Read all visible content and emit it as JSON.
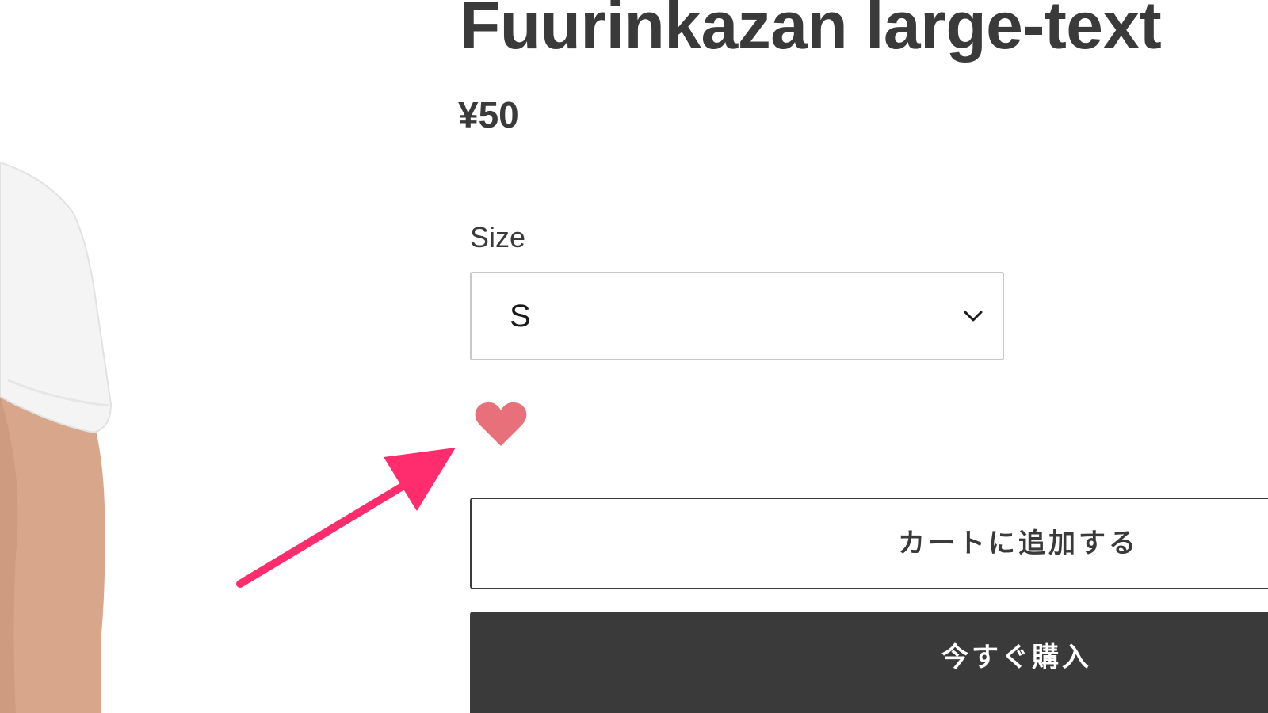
{
  "product": {
    "title": "Fuurinkazan large-text",
    "price": "¥50",
    "image_icon": "tshirt-model-photo"
  },
  "size_selector": {
    "label": "Size",
    "selected": "S",
    "icon": "chevron-down-icon"
  },
  "favorite": {
    "icon": "heart-icon",
    "color": "#e8707a"
  },
  "annotation": {
    "icon": "arrow-annotation",
    "color": "#ff2d6e"
  },
  "actions": {
    "add_to_cart_label": "カートに追加する",
    "buy_now_label": "今すぐ購入"
  },
  "colors": {
    "text": "#3a3a3a",
    "border_light": "#c8c8c8",
    "button_dark": "#3a3a3a"
  }
}
